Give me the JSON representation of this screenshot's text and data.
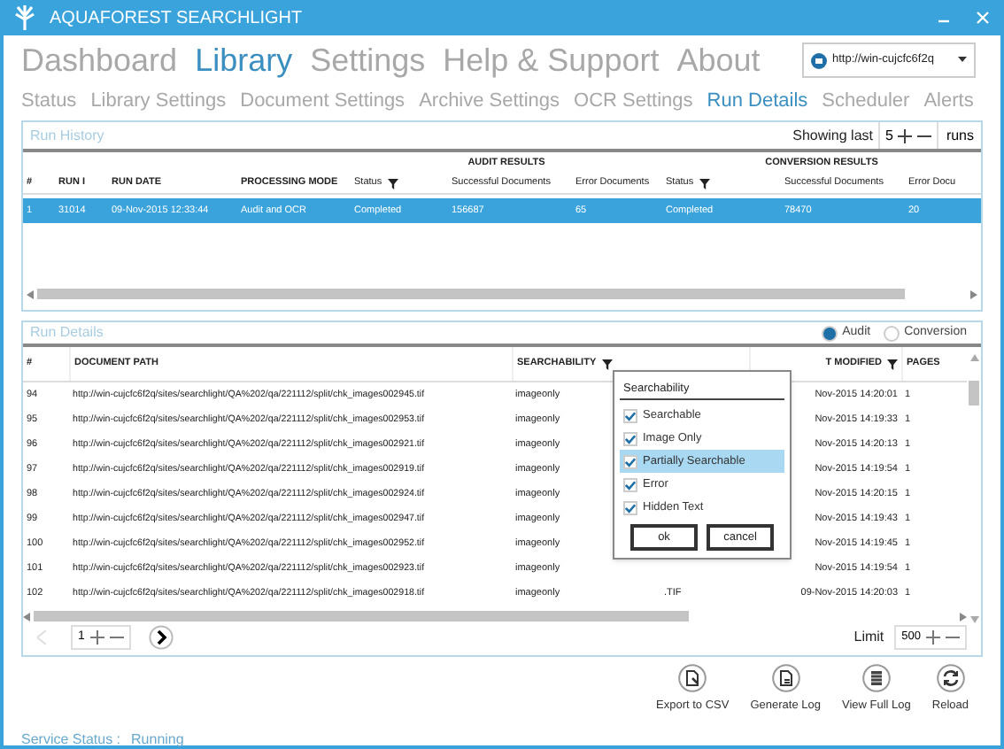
{
  "window": {
    "title": "AQUAFOREST SEARCHLIGHT"
  },
  "main_nav": [
    {
      "label": "Dashboard",
      "selected": false
    },
    {
      "label": "Library",
      "selected": true
    },
    {
      "label": "Settings",
      "selected": false
    },
    {
      "label": "Help & Support",
      "selected": false
    },
    {
      "label": "About",
      "selected": false
    }
  ],
  "server_select": {
    "value": "http://win-cujcfc6f2q"
  },
  "sub_nav": [
    {
      "label": "Status",
      "selected": false
    },
    {
      "label": "Library Settings",
      "selected": false
    },
    {
      "label": "Document Settings",
      "selected": false
    },
    {
      "label": "Archive Settings",
      "selected": false
    },
    {
      "label": "OCR Settings",
      "selected": false
    },
    {
      "label": "Run Details",
      "selected": true
    },
    {
      "label": "Scheduler",
      "selected": false
    },
    {
      "label": "Alerts",
      "selected": false
    }
  ],
  "run_history": {
    "title": "Run History",
    "showing_label": "Showing last",
    "count": "5",
    "runs_label": "runs",
    "group_headers": [
      "AUDIT RESULTS",
      "CONVERSION RESULTS"
    ],
    "columns": [
      {
        "label": "#",
        "filter": false
      },
      {
        "label": "RUN I",
        "filter": false
      },
      {
        "label": "RUN DATE",
        "filter": false
      },
      {
        "label": "PROCESSING MODE",
        "filter": false
      },
      {
        "label": "Status",
        "filter": true
      },
      {
        "label": "Successful Documents",
        "filter": false
      },
      {
        "label": "Error Documents",
        "filter": false
      },
      {
        "label": "Status",
        "filter": true
      },
      {
        "label": "Successful Documents",
        "filter": false
      },
      {
        "label": "Error Docu",
        "filter": false
      }
    ],
    "rows": [
      {
        "selected": true,
        "cells": [
          "1",
          "31014",
          "09-Nov-2015 12:33:44",
          "Audit and OCR",
          "Completed",
          "156687",
          "65",
          "Completed",
          "78470",
          "20"
        ]
      }
    ]
  },
  "run_details": {
    "title": "Run Details",
    "modes": [
      {
        "label": "Audit",
        "selected": true
      },
      {
        "label": "Conversion",
        "selected": false
      }
    ],
    "columns": [
      {
        "kind": "number",
        "label": "#",
        "filter": false
      },
      {
        "kind": "path",
        "label": "DOCUMENT PATH",
        "filter": false
      },
      {
        "kind": "searchability",
        "label": "SEARCHABILITY",
        "filter": true
      },
      {
        "kind": "modified",
        "label": "T MODIFIED",
        "filter": true
      },
      {
        "kind": "pages",
        "label": "PAGES",
        "filter": false
      }
    ],
    "rows": [
      {
        "number": "94",
        "path": "http://win-cujcfc6f2q/sites/searchlight/QA%202/qa/221112/split/chk_images002945.tif",
        "searchability": "imageonly",
        "last_modified": "Nov-2015 14:20:01",
        "pages": "1"
      },
      {
        "number": "95",
        "path": "http://win-cujcfc6f2q/sites/searchlight/QA%202/qa/221112/split/chk_images002953.tif",
        "searchability": "imageonly",
        "last_modified": "Nov-2015 14:19:33",
        "pages": "1"
      },
      {
        "number": "96",
        "path": "http://win-cujcfc6f2q/sites/searchlight/QA%202/qa/221112/split/chk_images002921.tif",
        "searchability": "imageonly",
        "last_modified": "Nov-2015 14:20:13",
        "pages": "1"
      },
      {
        "number": "97",
        "path": "http://win-cujcfc6f2q/sites/searchlight/QA%202/qa/221112/split/chk_images002919.tif",
        "searchability": "imageonly",
        "last_modified": "Nov-2015 14:19:54",
        "pages": "1"
      },
      {
        "number": "98",
        "path": "http://win-cujcfc6f2q/sites/searchlight/QA%202/qa/221112/split/chk_images002924.tif",
        "searchability": "imageonly",
        "last_modified": "Nov-2015 14:20:15",
        "pages": "1"
      },
      {
        "number": "99",
        "path": "http://win-cujcfc6f2q/sites/searchlight/QA%202/qa/221112/split/chk_images002947.tif",
        "searchability": "imageonly",
        "last_modified": "Nov-2015 14:19:43",
        "pages": "1"
      },
      {
        "number": "100",
        "path": "http://win-cujcfc6f2q/sites/searchlight/QA%202/qa/221112/split/chk_images002952.tif",
        "searchability": "imageonly",
        "last_modified": "Nov-2015 14:19:45",
        "pages": "1"
      },
      {
        "number": "101",
        "path": "http://win-cujcfc6f2q/sites/searchlight/QA%202/qa/221112/split/chk_images002923.tif",
        "searchability": "imageonly",
        "last_modified": "Nov-2015 14:19:54",
        "pages": "1"
      },
      {
        "number": "102",
        "path": "http://win-cujcfc6f2q/sites/searchlight/QA%202/qa/221112/split/chk_images002918.tif",
        "searchability": "imageonly",
        "status": ".TIF",
        "last_modified": "09-Nov-2015 14:20:03",
        "pages": "1"
      }
    ],
    "page": "1",
    "limit_label": "Limit",
    "limit": "500"
  },
  "filter_popup": {
    "title": "Searchability",
    "options": [
      {
        "label": "Searchable",
        "checked": true,
        "selected": false
      },
      {
        "label": "Image Only",
        "checked": true,
        "selected": false
      },
      {
        "label": "Partially Searchable",
        "checked": true,
        "selected": true
      },
      {
        "label": "Error",
        "checked": true,
        "selected": false
      },
      {
        "label": "Hidden Text",
        "checked": true,
        "selected": false
      }
    ],
    "buttons": [
      "ok",
      "cancel"
    ]
  },
  "actions": [
    {
      "kind": "export",
      "label": "Export to CSV"
    },
    {
      "kind": "log",
      "label": "Generate Log"
    },
    {
      "kind": "view",
      "label": "View Full Log"
    },
    {
      "kind": "reload",
      "label": "Reload"
    }
  ],
  "status_bar": {
    "label": "Service Status :",
    "value": "Running"
  }
}
